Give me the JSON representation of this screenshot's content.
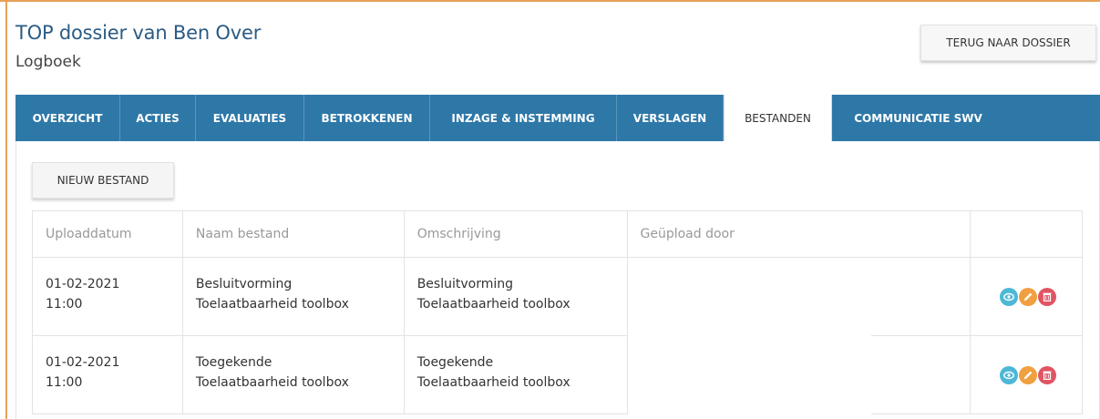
{
  "header": {
    "title": "TOP dossier van Ben Over",
    "subtitle": "Logboek",
    "back_button": "TERUG NAAR DOSSIER"
  },
  "tabs": [
    {
      "label": "OVERZICHT",
      "active": false
    },
    {
      "label": "ACTIES",
      "active": false
    },
    {
      "label": "EVALUATIES",
      "active": false
    },
    {
      "label": "BETROKKENEN",
      "active": false
    },
    {
      "label": "INZAGE & INSTEMMING",
      "active": false
    },
    {
      "label": "VERSLAGEN",
      "active": false
    },
    {
      "label": "BESTANDEN",
      "active": true
    },
    {
      "label": "COMMUNICATIE SWV",
      "active": false
    }
  ],
  "toolbar": {
    "new_file_button": "NIEUW BESTAND"
  },
  "table": {
    "columns": [
      "Uploaddatum",
      "Naam bestand",
      "Omschrijving",
      "Geüpload door",
      ""
    ],
    "rows": [
      {
        "date": "01-02-2021",
        "time": "11:00",
        "name_line1": "Besluitvorming",
        "name_line2": "Toelaatbaarheid toolbox",
        "desc_line1": "Besluitvorming",
        "desc_line2": "Toelaatbaarheid toolbox",
        "uploaded_by": ""
      },
      {
        "date": "01-02-2021",
        "time": "11:00",
        "name_line1": "Toegekende",
        "name_line2": "Toelaatbaarheid toolbox",
        "desc_line1": "Toegekende",
        "desc_line2": "Toelaatbaarheid toolbox",
        "uploaded_by": ""
      }
    ],
    "action_icons": [
      "eye-icon",
      "pencil-icon",
      "trash-icon"
    ]
  },
  "colors": {
    "accent_frame": "#e8a157",
    "tab_bar": "#2e78a8",
    "title": "#2b5b84",
    "view_icon": "#4db8d6",
    "edit_icon": "#f0a040",
    "delete_icon": "#e05563"
  }
}
